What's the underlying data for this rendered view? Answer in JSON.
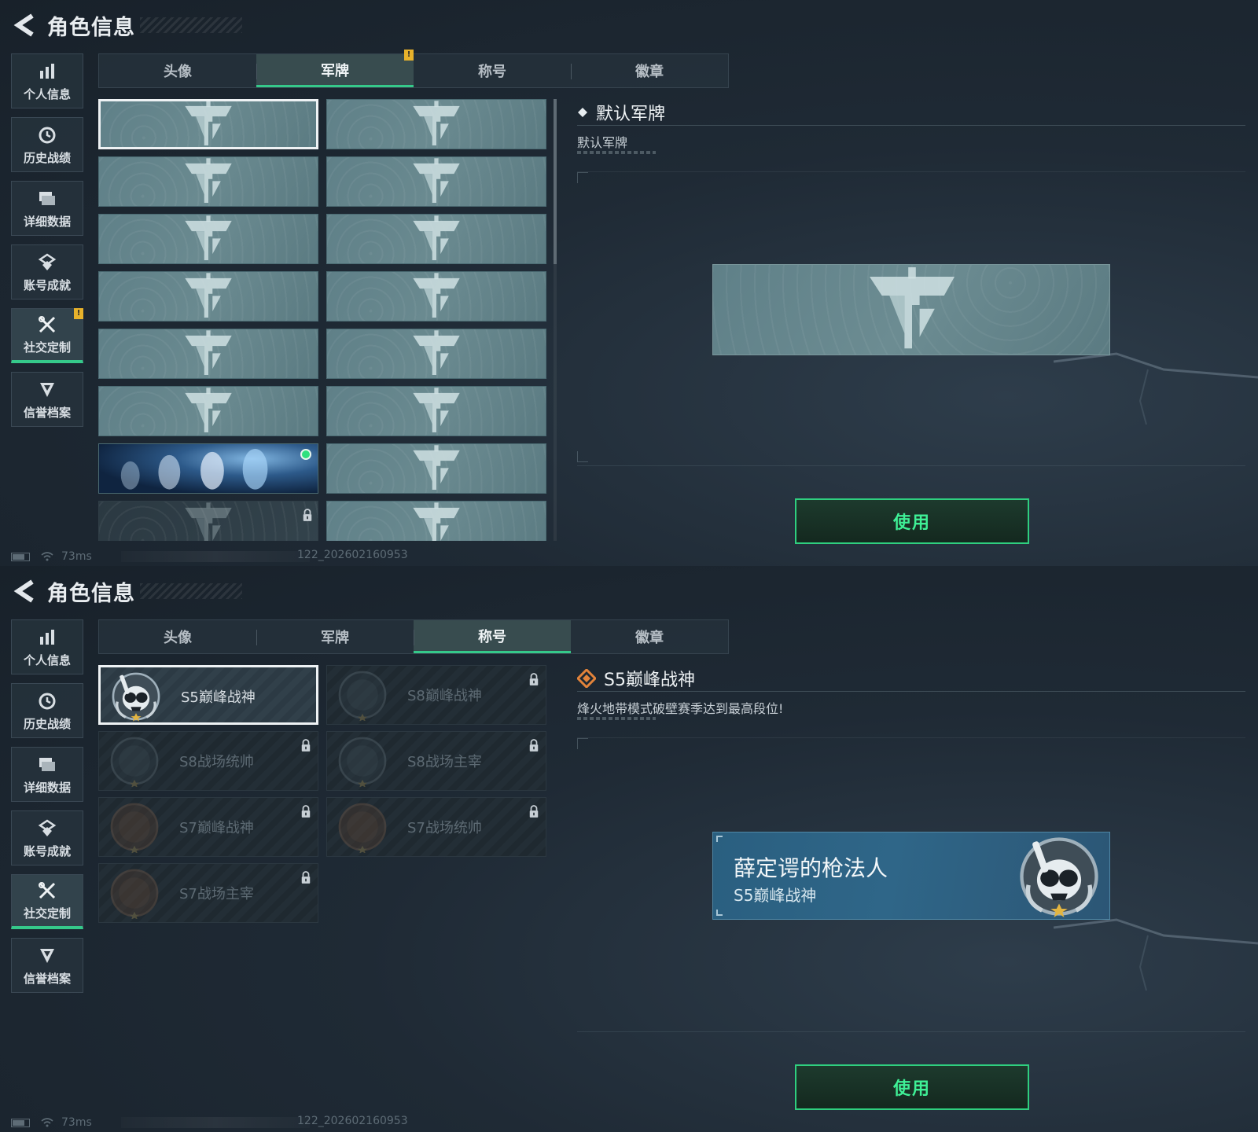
{
  "header": {
    "title": "角色信息"
  },
  "sidebar": {
    "items": [
      {
        "label": "个人信息",
        "icon": "bar-chart-icon"
      },
      {
        "label": "历史战绩",
        "icon": "history-clock-icon"
      },
      {
        "label": "详细数据",
        "icon": "folder-data-icon"
      },
      {
        "label": "账号成就",
        "icon": "achievement-icon"
      },
      {
        "label": "社交定制",
        "icon": "tools-icon",
        "active": true,
        "badge": "!"
      },
      {
        "label": "信誉档案",
        "icon": "shield-chevron-icon"
      }
    ]
  },
  "tabs": [
    "头像",
    "军牌",
    "称号",
    "徽章"
  ],
  "top_panel": {
    "active_tab": "军牌",
    "tab_badge": "!",
    "dog_tags": [
      {
        "state": "selected"
      },
      {
        "state": "normal"
      },
      {
        "state": "normal"
      },
      {
        "state": "normal"
      },
      {
        "state": "normal"
      },
      {
        "state": "normal"
      },
      {
        "state": "normal"
      },
      {
        "state": "normal"
      },
      {
        "state": "normal"
      },
      {
        "state": "normal"
      },
      {
        "state": "normal"
      },
      {
        "state": "normal"
      },
      {
        "state": "skeleton",
        "owned": true
      },
      {
        "state": "normal"
      },
      {
        "state": "locked"
      },
      {
        "state": "normal"
      }
    ],
    "detail": {
      "title": "默认军牌",
      "description": "默认军牌"
    },
    "use_button": "使用"
  },
  "bottom_panel": {
    "active_tab": "称号",
    "titles": [
      {
        "name": "S5巅峰战神",
        "selected": true,
        "locked": false,
        "icon": "skull-snorkel-badge-icon"
      },
      {
        "name": "S8巅峰战神",
        "selected": false,
        "locked": true,
        "icon": "stripe-emblem-badge-icon"
      },
      {
        "name": "S8战场统帅",
        "selected": false,
        "locked": true,
        "icon": "tank-badge-icon"
      },
      {
        "name": "S8战场主宰",
        "selected": false,
        "locked": true,
        "icon": "building-badge-icon"
      },
      {
        "name": "S7巅峰战神",
        "selected": false,
        "locked": true,
        "icon": "gun-badge-icon"
      },
      {
        "name": "S7战场统帅",
        "selected": false,
        "locked": true,
        "icon": "vehicle-badge-icon"
      },
      {
        "name": "S7战场主宰",
        "selected": false,
        "locked": true,
        "icon": "soldier-badge-icon"
      }
    ],
    "detail": {
      "title": "S5巅峰战神",
      "description": "烽火地带模式破壁赛季达到最高段位!"
    },
    "nameplate": {
      "player_name": "薛定谔的枪法人",
      "title": "S5巅峰战神"
    },
    "use_button": "使用"
  },
  "status": {
    "ping": "73ms",
    "build": "122_202602160953"
  },
  "colors": {
    "accent_green": "#35c98a",
    "button_text": "#3ff096",
    "badge_yellow": "#e8b22b",
    "tag_teal": "#6a8a90",
    "nameplate_blue": "#2f6688"
  }
}
